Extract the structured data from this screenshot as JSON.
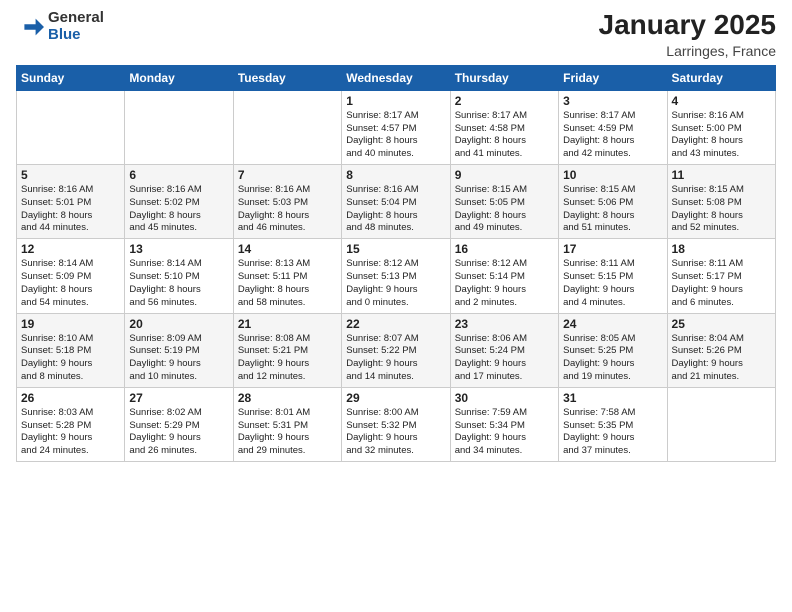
{
  "header": {
    "logo_general": "General",
    "logo_blue": "Blue",
    "month": "January 2025",
    "location": "Larringes, France"
  },
  "days_of_week": [
    "Sunday",
    "Monday",
    "Tuesday",
    "Wednesday",
    "Thursday",
    "Friday",
    "Saturday"
  ],
  "weeks": [
    [
      {
        "day": "",
        "info": ""
      },
      {
        "day": "",
        "info": ""
      },
      {
        "day": "",
        "info": ""
      },
      {
        "day": "1",
        "info": "Sunrise: 8:17 AM\nSunset: 4:57 PM\nDaylight: 8 hours\nand 40 minutes."
      },
      {
        "day": "2",
        "info": "Sunrise: 8:17 AM\nSunset: 4:58 PM\nDaylight: 8 hours\nand 41 minutes."
      },
      {
        "day": "3",
        "info": "Sunrise: 8:17 AM\nSunset: 4:59 PM\nDaylight: 8 hours\nand 42 minutes."
      },
      {
        "day": "4",
        "info": "Sunrise: 8:16 AM\nSunset: 5:00 PM\nDaylight: 8 hours\nand 43 minutes."
      }
    ],
    [
      {
        "day": "5",
        "info": "Sunrise: 8:16 AM\nSunset: 5:01 PM\nDaylight: 8 hours\nand 44 minutes."
      },
      {
        "day": "6",
        "info": "Sunrise: 8:16 AM\nSunset: 5:02 PM\nDaylight: 8 hours\nand 45 minutes."
      },
      {
        "day": "7",
        "info": "Sunrise: 8:16 AM\nSunset: 5:03 PM\nDaylight: 8 hours\nand 46 minutes."
      },
      {
        "day": "8",
        "info": "Sunrise: 8:16 AM\nSunset: 5:04 PM\nDaylight: 8 hours\nand 48 minutes."
      },
      {
        "day": "9",
        "info": "Sunrise: 8:15 AM\nSunset: 5:05 PM\nDaylight: 8 hours\nand 49 minutes."
      },
      {
        "day": "10",
        "info": "Sunrise: 8:15 AM\nSunset: 5:06 PM\nDaylight: 8 hours\nand 51 minutes."
      },
      {
        "day": "11",
        "info": "Sunrise: 8:15 AM\nSunset: 5:08 PM\nDaylight: 8 hours\nand 52 minutes."
      }
    ],
    [
      {
        "day": "12",
        "info": "Sunrise: 8:14 AM\nSunset: 5:09 PM\nDaylight: 8 hours\nand 54 minutes."
      },
      {
        "day": "13",
        "info": "Sunrise: 8:14 AM\nSunset: 5:10 PM\nDaylight: 8 hours\nand 56 minutes."
      },
      {
        "day": "14",
        "info": "Sunrise: 8:13 AM\nSunset: 5:11 PM\nDaylight: 8 hours\nand 58 minutes."
      },
      {
        "day": "15",
        "info": "Sunrise: 8:12 AM\nSunset: 5:13 PM\nDaylight: 9 hours\nand 0 minutes."
      },
      {
        "day": "16",
        "info": "Sunrise: 8:12 AM\nSunset: 5:14 PM\nDaylight: 9 hours\nand 2 minutes."
      },
      {
        "day": "17",
        "info": "Sunrise: 8:11 AM\nSunset: 5:15 PM\nDaylight: 9 hours\nand 4 minutes."
      },
      {
        "day": "18",
        "info": "Sunrise: 8:11 AM\nSunset: 5:17 PM\nDaylight: 9 hours\nand 6 minutes."
      }
    ],
    [
      {
        "day": "19",
        "info": "Sunrise: 8:10 AM\nSunset: 5:18 PM\nDaylight: 9 hours\nand 8 minutes."
      },
      {
        "day": "20",
        "info": "Sunrise: 8:09 AM\nSunset: 5:19 PM\nDaylight: 9 hours\nand 10 minutes."
      },
      {
        "day": "21",
        "info": "Sunrise: 8:08 AM\nSunset: 5:21 PM\nDaylight: 9 hours\nand 12 minutes."
      },
      {
        "day": "22",
        "info": "Sunrise: 8:07 AM\nSunset: 5:22 PM\nDaylight: 9 hours\nand 14 minutes."
      },
      {
        "day": "23",
        "info": "Sunrise: 8:06 AM\nSunset: 5:24 PM\nDaylight: 9 hours\nand 17 minutes."
      },
      {
        "day": "24",
        "info": "Sunrise: 8:05 AM\nSunset: 5:25 PM\nDaylight: 9 hours\nand 19 minutes."
      },
      {
        "day": "25",
        "info": "Sunrise: 8:04 AM\nSunset: 5:26 PM\nDaylight: 9 hours\nand 21 minutes."
      }
    ],
    [
      {
        "day": "26",
        "info": "Sunrise: 8:03 AM\nSunset: 5:28 PM\nDaylight: 9 hours\nand 24 minutes."
      },
      {
        "day": "27",
        "info": "Sunrise: 8:02 AM\nSunset: 5:29 PM\nDaylight: 9 hours\nand 26 minutes."
      },
      {
        "day": "28",
        "info": "Sunrise: 8:01 AM\nSunset: 5:31 PM\nDaylight: 9 hours\nand 29 minutes."
      },
      {
        "day": "29",
        "info": "Sunrise: 8:00 AM\nSunset: 5:32 PM\nDaylight: 9 hours\nand 32 minutes."
      },
      {
        "day": "30",
        "info": "Sunrise: 7:59 AM\nSunset: 5:34 PM\nDaylight: 9 hours\nand 34 minutes."
      },
      {
        "day": "31",
        "info": "Sunrise: 7:58 AM\nSunset: 5:35 PM\nDaylight: 9 hours\nand 37 minutes."
      },
      {
        "day": "",
        "info": ""
      }
    ]
  ]
}
